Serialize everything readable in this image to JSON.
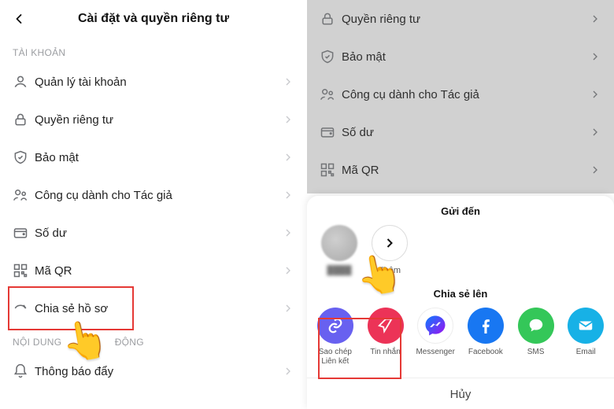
{
  "left": {
    "title": "Cài đặt và quyền riêng tư",
    "section_account": "TÀI KHOẢN",
    "section_content": "NỘI DUNG",
    "section_activity_suffix": "ĐỘNG",
    "rows": {
      "manage": "Quản lý tài khoản",
      "privacy": "Quyền riêng tư",
      "security": "Bảo mật",
      "creator": "Công cụ dành cho Tác giả",
      "balance": "Số dư",
      "qr": "Mã QR",
      "share": "Chia sẻ hồ sơ",
      "push": "Thông báo đẩy"
    }
  },
  "right": {
    "rows": {
      "privacy": "Quyền riêng tư",
      "security": "Bảo mật",
      "creator": "Công cụ dành cho Tác giả",
      "balance": "Số dư",
      "qr": "Mã QR"
    },
    "sheet": {
      "send_to": "Gửi đến",
      "more": "Thêm",
      "share_to": "Chia sẻ lên",
      "options": {
        "copylink": "Sao chép Liên kết",
        "dm": "Tin nhắn",
        "messenger": "Messenger",
        "facebook": "Facebook",
        "sms": "SMS",
        "email": "Email"
      },
      "cancel": "Hủy"
    }
  }
}
